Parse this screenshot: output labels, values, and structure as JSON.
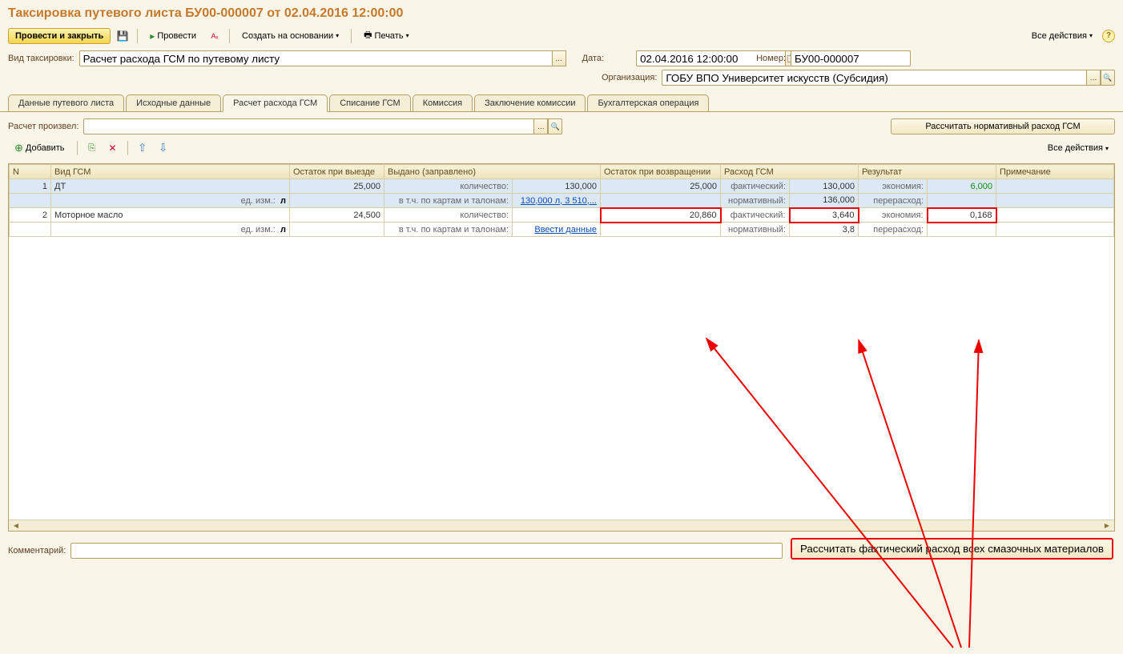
{
  "title": "Таксировка путевого листа БУ00-000007 от 02.04.2016 12:00:00",
  "toolbar": {
    "post_close": "Провести и закрыть",
    "post": "Провести",
    "create_based": "Создать на основании",
    "print": "Печать",
    "all_actions": "Все действия"
  },
  "fields": {
    "tax_type_label": "Вид таксировки:",
    "tax_type_value": "Расчет расхода ГСМ по путевому листу",
    "date_label": "Дата:",
    "date_value": "02.04.2016 12:00:00",
    "number_label": "Номер:",
    "number_value": "БУ00-000007",
    "org_label": "Организация:",
    "org_value": "ГОБУ ВПО Университет искусств (Субсидия)",
    "calc_by_label": "Расчет произвел:",
    "calc_by_value": "",
    "calc_norm_btn": "Рассчитать нормативный расход ГСМ",
    "comment_label": "Комментарий:",
    "comment_value": ""
  },
  "tabs": [
    "Данные путевого листа",
    "Исходные данные",
    "Расчет расхода ГСМ",
    "Списание ГСМ",
    "Комиссия",
    "Заключение комиссии",
    "Бухгалтерская операция"
  ],
  "active_tab": 2,
  "grid_toolbar": {
    "add": "Добавить",
    "all_actions": "Все действия"
  },
  "grid": {
    "headers": [
      "N",
      "Вид ГСМ",
      "Остаток при выезде",
      "Выдано (заправлено)",
      "Остаток при возвращении",
      "Расход ГСМ",
      "Результат",
      "Примечание"
    ],
    "sub_labels": {
      "unit": "ед. изм.:",
      "qty": "количество:",
      "by_cards": "в т.ч. по картам и талонам:",
      "enter_data": "Ввести данные",
      "fact": "фактический:",
      "norm": "нормативный:",
      "economy": "экономия:",
      "overrun": "перерасход:"
    },
    "rows": [
      {
        "n": 1,
        "name": "ДТ",
        "unit": "л",
        "out_balance": "25,000",
        "issued_qty": "130,000",
        "issued_cards": "130,000 л, 3 510,...",
        "return_balance": "25,000",
        "fact": "130,000",
        "norm": "136,000",
        "economy": "6,000",
        "overrun": "",
        "note": ""
      },
      {
        "n": 2,
        "name": "Моторное масло",
        "unit": "л",
        "out_balance": "24,500",
        "issued_qty": "",
        "issued_cards_link": "Ввести данные",
        "return_balance": "20,860",
        "fact": "3,640",
        "norm": "3,8",
        "economy": "0,168",
        "overrun": "",
        "note": ""
      }
    ]
  },
  "bottom_button": "Рассчитать фактический расход всех смазочных материалов"
}
